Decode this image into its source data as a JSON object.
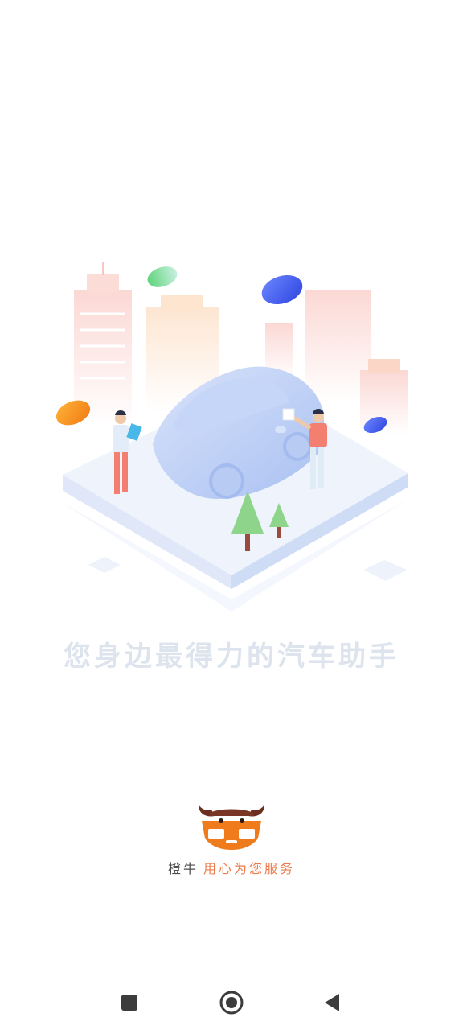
{
  "tagline": "您身边最得力的汽车助手",
  "brand": {
    "name": "橙牛",
    "motto": "用心为您服务"
  },
  "colors": {
    "accent": "#ef7a4a",
    "tagline": "#dde4ee",
    "car": "#b9cdf5",
    "platform": "#e8eefb"
  },
  "navbar": {
    "icons": [
      "square-icon",
      "circle-icon",
      "back-triangle-icon"
    ]
  }
}
